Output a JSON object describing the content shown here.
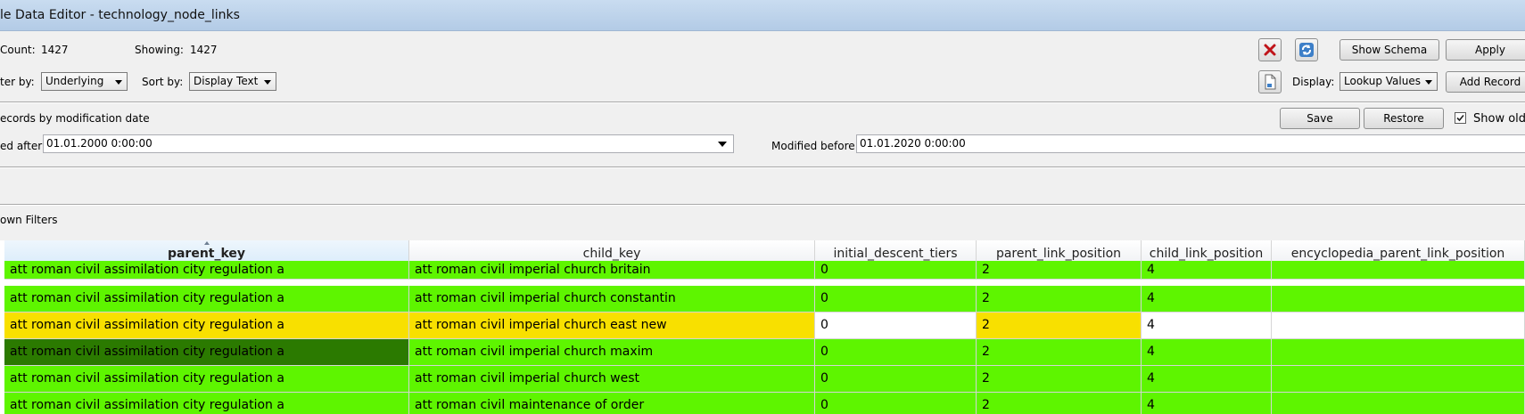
{
  "window": {
    "title": "le Data Editor - technology_node_links"
  },
  "info": {
    "count_label": "Count:",
    "count_value": "1427",
    "showing_label": "Showing:",
    "showing_value": "1427"
  },
  "filter": {
    "filter_label": "ter by:",
    "filter_value": "Underlying",
    "sort_label": "Sort by:",
    "sort_value": "Display Text"
  },
  "toolbar": {
    "show_schema": "Show Schema",
    "apply": "Apply",
    "display_label": "Display:",
    "display_value": "Lookup Values",
    "add_record": "Add Record"
  },
  "modification": {
    "section_label": "ecords by modification date",
    "save": "Save",
    "restore": "Restore",
    "show_old_label": "Show old r",
    "show_old_checked": true,
    "after_label": "ed after:",
    "after_value": "01.01.2000 0:00:00",
    "before_label": "Modified before:",
    "before_value": "01.01.2020 0:00:00"
  },
  "known_filters_label": "own Filters",
  "grid": {
    "columns": [
      "parent_key",
      "child_key",
      "initial_descent_tiers",
      "parent_link_position",
      "child_link_position",
      "encyclopedia_parent_link_position"
    ],
    "rows": [
      [
        "att roman civil assimilation city regulation a",
        "att roman civil imperial church britain",
        "0",
        "2",
        "4",
        ""
      ],
      [
        "att roman civil assimilation city regulation a",
        "att roman civil imperial church constantin",
        "0",
        "2",
        "4",
        ""
      ],
      [
        "att roman civil assimilation city regulation a",
        "att roman civil imperial church east new",
        "0",
        "2",
        "4",
        ""
      ],
      [
        "att roman civil assimilation city regulation a",
        "att roman civil imperial church maxim",
        "0",
        "2",
        "4",
        ""
      ],
      [
        "att roman civil assimilation city regulation a",
        "att roman civil imperial church west",
        "0",
        "2",
        "4",
        ""
      ],
      [
        "att roman civil assimilation city regulation a",
        "att roman civil maintenance of order",
        "0",
        "2",
        "4",
        ""
      ]
    ]
  },
  "colors": {
    "row_green": "#5ef500",
    "row_yellow": "#f8e000",
    "selected_cell": "#2b7a00",
    "white_cell": "#ffffff"
  }
}
